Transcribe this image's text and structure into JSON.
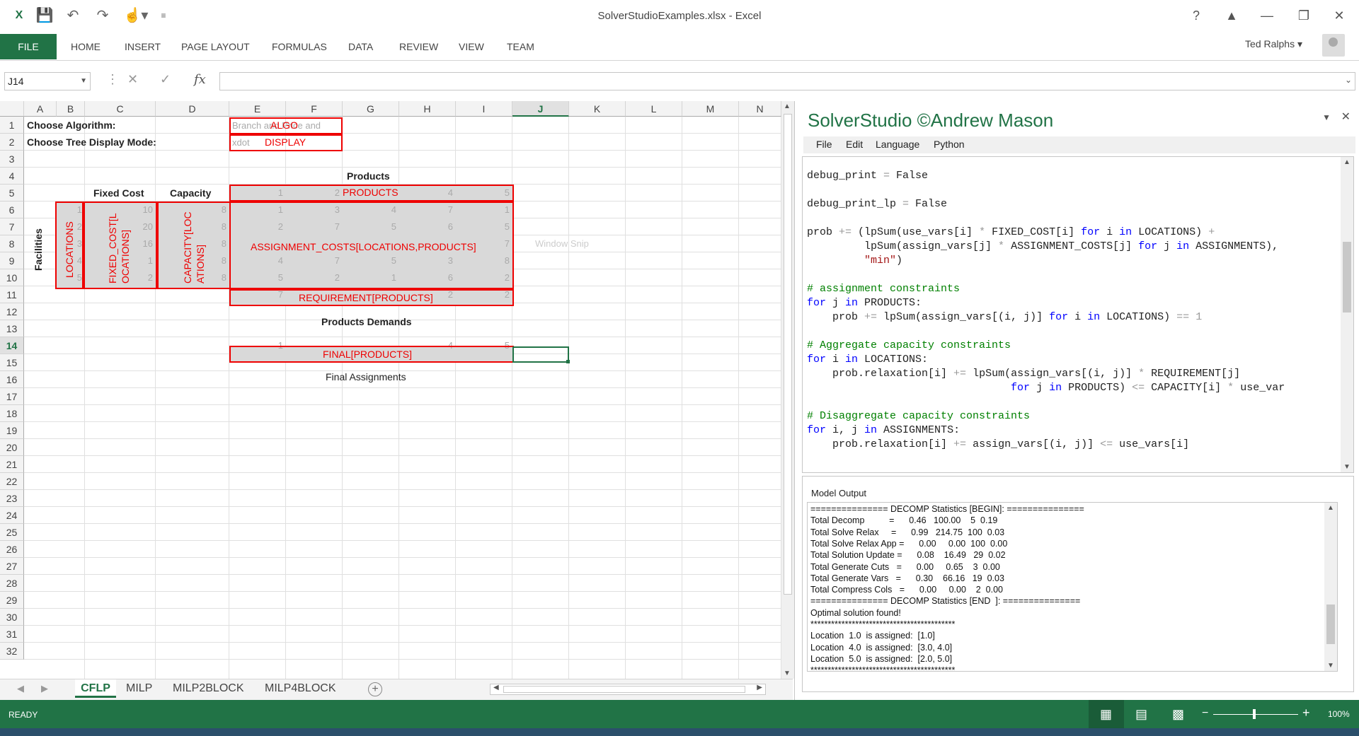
{
  "window": {
    "title": "SolverStudioExamples.xlsx - Excel"
  },
  "ribbon": {
    "file": "FILE",
    "tabs": [
      "HOME",
      "INSERT",
      "PAGE LAYOUT",
      "FORMULAS",
      "DATA",
      "REVIEW",
      "VIEW",
      "TEAM"
    ],
    "user": "Ted Ralphs"
  },
  "formula_bar": {
    "name_box": "J14",
    "fx": "fx",
    "formula": ""
  },
  "columns": [
    "A",
    "B",
    "C",
    "D",
    "E",
    "F",
    "G",
    "H",
    "I",
    "J",
    "K",
    "L",
    "M",
    "N"
  ],
  "selected_column": "J",
  "rows": [
    "1",
    "2",
    "3",
    "4",
    "5",
    "6",
    "7",
    "8",
    "9",
    "10",
    "11",
    "12",
    "13",
    "14",
    "15",
    "16",
    "17",
    "18",
    "19",
    "20",
    "21",
    "22",
    "23",
    "24",
    "25",
    "26",
    "27",
    "28",
    "29",
    "30",
    "31",
    "32"
  ],
  "selected_row": "14",
  "cells": {
    "a1": "Choose Algorithm:",
    "a2": "Choose  Tree Display Mode:",
    "e1_gray": "Branch and Price and",
    "e2_gray": "xdot",
    "algo": "ALGO",
    "display": "DISPLAY",
    "products_header": "Products",
    "fixed_cost_header": "Fixed Cost",
    "capacity_header": "Capacity",
    "facilities": "Facilities",
    "products_range": "PRODUCTS",
    "locations_range": "LOCATIONS",
    "fixed_cost_range": "FIXED_COST[L OCATIONS]",
    "capacity_range": "CAPACITY[LOC ATIONS]",
    "assignment_range": "ASSIGNMENT_COSTS[LOCATIONS,PRODUCTS]",
    "requirement_range": "REQUIREMENT[PRODUCTS]",
    "products_demands": "Products Demands",
    "final_range": "FINAL[PRODUCTS]",
    "final_assignments": "Final Assignments",
    "ghost": "Window Snip",
    "products_values": [
      "1",
      "2",
      "",
      "4",
      "5"
    ],
    "locations_values": [
      "1",
      "2",
      "3",
      "4",
      "5"
    ],
    "fixed_cost_values": [
      "10",
      "20",
      "16",
      "1",
      "2"
    ],
    "capacity_values": [
      "8",
      "8",
      "8",
      "8",
      "8"
    ],
    "assignment_rows": [
      [
        "1",
        "3",
        "4",
        "7",
        "1"
      ],
      [
        "2",
        "7",
        "5",
        "6",
        "5"
      ],
      [
        "",
        "",
        "",
        "",
        "7"
      ],
      [
        "4",
        "7",
        "5",
        "3",
        "8"
      ],
      [
        "5",
        "2",
        "1",
        "6",
        "2"
      ]
    ],
    "requirement_values": [
      "7",
      "",
      "",
      "2",
      "2"
    ],
    "final_values": [
      "1",
      "",
      "",
      "4",
      "5"
    ]
  },
  "sheet_tabs": [
    "CFLP",
    "MILP",
    "MILP2BLOCK",
    "MILP4BLOCK"
  ],
  "active_sheet": "CFLP",
  "status": {
    "ready": "READY",
    "zoom": "100%"
  },
  "solver": {
    "title": "SolverStudio ©Andrew Mason",
    "menu": [
      "File",
      "Edit",
      "Language",
      "Python"
    ],
    "output_label": "Model Output",
    "output_lines": [
      "=============== DECOMP Statistics [BEGIN]: ===============",
      "Total Decomp          =      0.46   100.00    5  0.19",
      "Total Solve Relax     =      0.99   214.75  100  0.03",
      "Total Solve Relax App =      0.00     0.00  100  0.00",
      "Total Solution Update =      0.08    16.49   29  0.02",
      "Total Generate Cuts   =      0.00     0.65    3  0.00",
      "Total Generate Vars   =      0.30    66.16   19  0.03",
      "Total Compress Cols   =      0.00     0.00    2  0.00",
      "=============== DECOMP Statistics [END  ]: ===============",
      "Optimal solution found!",
      "******************************************",
      "Location  1.0  is assigned:  [1.0]",
      "Location  4.0  is assigned:  [3.0, 4.0]",
      "Location  5.0  is assigned:  [2.0, 5.0]",
      "******************************************"
    ]
  }
}
